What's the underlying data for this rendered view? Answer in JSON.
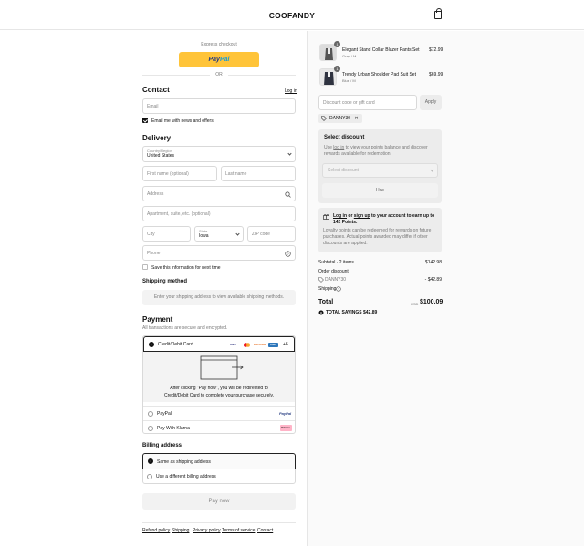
{
  "header": {
    "brand": "COOFANDY",
    "bag_icon": "shopping-bag-icon"
  },
  "express": {
    "title": "Express checkout",
    "paypal_pay": "Pay",
    "paypal_pal": "Pal",
    "or": "OR"
  },
  "contact": {
    "title": "Contact",
    "login": "Log in",
    "email_placeholder": "Email",
    "newsletter_label": "Email me with news and offers",
    "newsletter_checked": true
  },
  "delivery": {
    "title": "Delivery",
    "country_label": "Country/Region",
    "country_value": "United States",
    "first_name": "First name (optional)",
    "last_name": "Last name",
    "address": "Address",
    "apartment": "Apartment, suite, etc. (optional)",
    "city": "City",
    "state_label": "State",
    "state_value": "Iowa",
    "zip": "ZIP code",
    "phone": "Phone",
    "save_info": "Save this information for next time"
  },
  "shipping": {
    "title": "Shipping method",
    "note": "Enter your shipping address to view available shipping methods."
  },
  "payment": {
    "title": "Payment",
    "subtitle": "All transactions are secure and encrypted.",
    "card_option": "Credit/Debit Card",
    "card_logos": [
      "VISA",
      "MC",
      "DISCOVER",
      "AMEX"
    ],
    "more_cards": "+6",
    "redirect_text_1": "After clicking “Pay now”, you will be redirected to",
    "redirect_text_2": "Credit/Debit Card to complete your purchase securely.",
    "paypal_option": "PayPal",
    "paypal_logo": "PayPal",
    "klarna_option": "Pay With Klarna",
    "klarna_logo": "Klarna."
  },
  "billing": {
    "title": "Billing address",
    "same": "Same as shipping address",
    "different": "Use a different billing address"
  },
  "pay_now": "Pay now",
  "footer_links": [
    "Refund policy",
    "Shipping",
    "Privacy policy",
    "Terms of service",
    "Contact"
  ],
  "order": {
    "items": [
      {
        "name": "Elegant Stand Collar Blazer Pants Set",
        "variant": "Gray / M",
        "price": "$72.99",
        "qty": "1"
      },
      {
        "name": "Trendy Urban Shoulder Pad Suit Set",
        "variant": "Blue / M",
        "price": "$69.99",
        "qty": "1"
      }
    ],
    "discount_placeholder": "Discount code or gift card",
    "apply": "Apply",
    "applied_code": "DANNY30",
    "select_discount": {
      "title": "Select discount",
      "text_pre": "Use",
      "text_link": "log in",
      "text_post": "to view your points balance and discover rewards available for redemption.",
      "dropdown": "Select discount",
      "use": "Use"
    },
    "points": {
      "login": "Log in",
      "or": "or",
      "signup": "sign up",
      "rest": "to your account to earn up to 142 Points.",
      "note": "Loyalty points can be redeemed for rewards on future purchases. Actual points awarded may differ if other discounts are applied."
    },
    "subtotal_label": "Subtotal · 2 items",
    "subtotal_value": "$142.98",
    "order_discount_label": "Order discount",
    "discount_code": "DANNY30",
    "discount_value": "- $42.89",
    "shipping_label": "Shipping",
    "total_label": "Total",
    "currency": "USD",
    "total_value": "$100.09",
    "savings_label": "TOTAL SAVINGS",
    "savings_value": "$42.89"
  }
}
